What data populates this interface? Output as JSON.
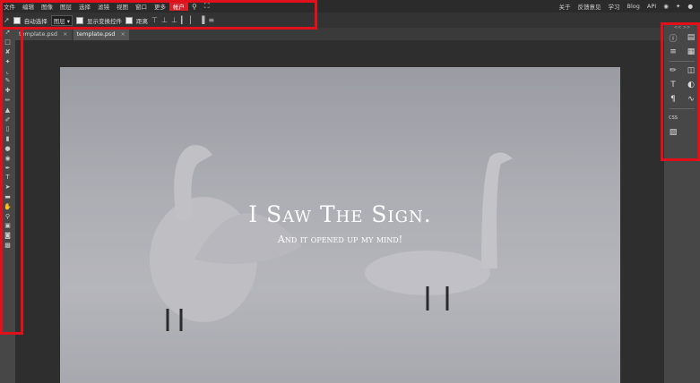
{
  "menu": {
    "items": [
      "文件",
      "编辑",
      "图像",
      "图层",
      "选择",
      "滤镜",
      "视图",
      "窗口",
      "更多"
    ],
    "account": "帐户",
    "icons": [
      "search-icon",
      "fullscreen-icon"
    ],
    "right_links": [
      "关于",
      "反馈意见",
      "学习",
      "Blog",
      "API"
    ],
    "social_icons": [
      "reddit-icon",
      "twitter-icon",
      "facebook-icon"
    ]
  },
  "options": {
    "auto_select_label": "自动选择",
    "layer_select_value": "图层",
    "transform_controls_label": "显示变换控件",
    "distance_label": "距离"
  },
  "tabs": [
    {
      "label": "template.psd",
      "close": "×"
    },
    {
      "label": "template.psd",
      "close": "×"
    }
  ],
  "canvas": {
    "headline": "I Saw The Sign.",
    "subline": "And it opened up my mind!"
  },
  "tools": [
    "move",
    "marquee",
    "lasso",
    "magic-wand",
    "crop",
    "eyedropper",
    "healing",
    "brush",
    "stamp",
    "history-brush",
    "eraser",
    "gradient",
    "blur",
    "dodge",
    "pen",
    "type",
    "path-select",
    "shape",
    "hand",
    "zoom"
  ],
  "right_panel": {
    "collapse": "<<  >>",
    "rows": [
      [
        "info-icon",
        "properties-icon"
      ],
      [
        "paragraph-list-icon",
        "layers-icon"
      ],
      [
        "brush-icon",
        "channels-icon"
      ],
      [
        "type-icon",
        "adjustments-icon"
      ],
      [
        "paragraph-icon",
        "curves-icon"
      ]
    ],
    "css_label": "CSS",
    "image_icon": "image-icon"
  },
  "colors": {
    "highlight_red": "#e0111b",
    "active_menu": "#d61f26"
  }
}
